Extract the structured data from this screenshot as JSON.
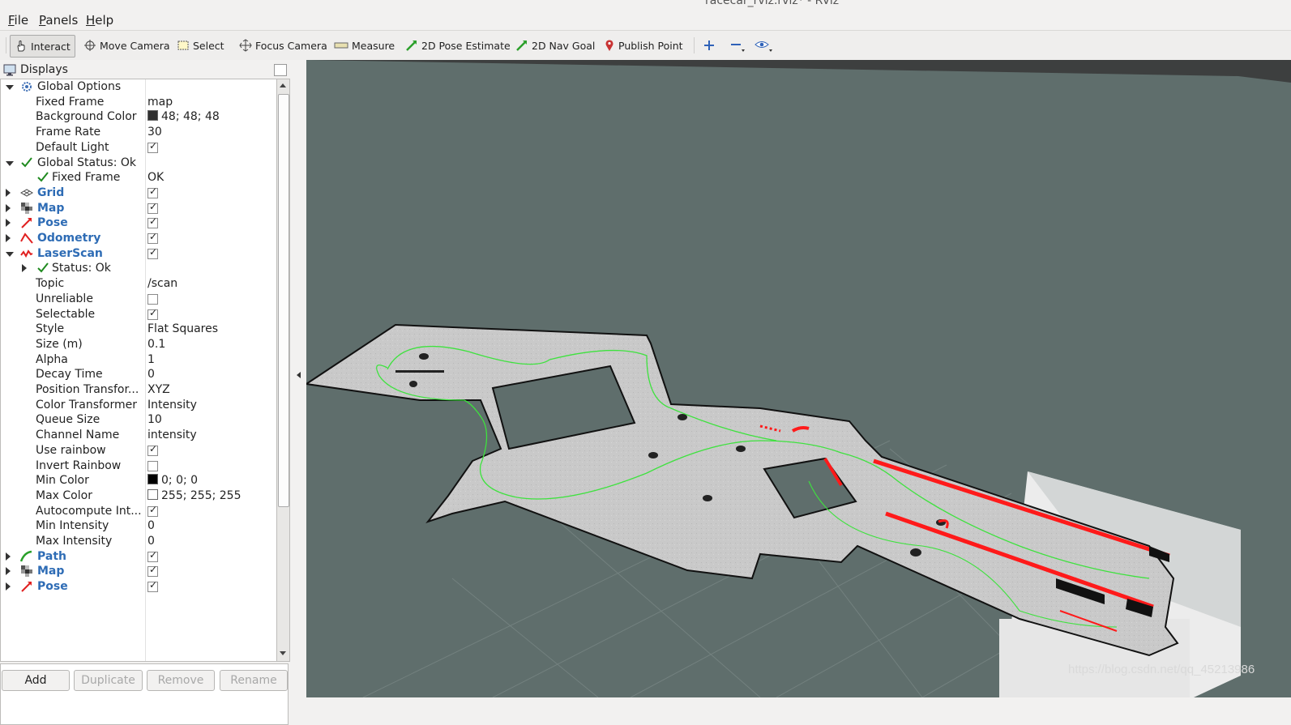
{
  "window": {
    "title": "racecar_rviz.rviz* - RViz"
  },
  "menu": {
    "file": "File",
    "panels": "Panels",
    "help": "Help"
  },
  "toolbar": {
    "interact": "Interact",
    "move_camera": "Move Camera",
    "select": "Select",
    "focus_camera": "Focus Camera",
    "measure": "Measure",
    "pose_estimate": "2D Pose Estimate",
    "nav_goal": "2D Nav Goal",
    "publish_point": "Publish Point"
  },
  "displays_panel": {
    "title": "Displays",
    "rows": [
      {
        "label": "Global Options",
        "value": ""
      },
      {
        "label": "Fixed Frame",
        "value": "map"
      },
      {
        "label": "Background Color",
        "value": "48; 48; 48",
        "color": "#303030"
      },
      {
        "label": "Frame Rate",
        "value": "30"
      },
      {
        "label": "Default Light",
        "checked": true
      },
      {
        "label": "Global Status: Ok",
        "value": ""
      },
      {
        "label": "Fixed Frame",
        "value": "OK"
      },
      {
        "label": "Grid",
        "checked": true
      },
      {
        "label": "Map",
        "checked": true
      },
      {
        "label": "Pose",
        "checked": true
      },
      {
        "label": "Odometry",
        "checked": true
      },
      {
        "label": "LaserScan",
        "checked": true
      },
      {
        "label": "Status: Ok",
        "value": ""
      },
      {
        "label": "Topic",
        "value": "/scan"
      },
      {
        "label": "Unreliable",
        "checked": false
      },
      {
        "label": "Selectable",
        "checked": true
      },
      {
        "label": "Style",
        "value": "Flat Squares"
      },
      {
        "label": "Size (m)",
        "value": "0.1"
      },
      {
        "label": "Alpha",
        "value": "1"
      },
      {
        "label": "Decay Time",
        "value": "0"
      },
      {
        "label": "Position Transfor...",
        "value": "XYZ"
      },
      {
        "label": "Color Transformer",
        "value": "Intensity"
      },
      {
        "label": "Queue Size",
        "value": "10"
      },
      {
        "label": "Channel Name",
        "value": "intensity"
      },
      {
        "label": "Use rainbow",
        "checked": true
      },
      {
        "label": "Invert Rainbow",
        "checked": false
      },
      {
        "label": "Min Color",
        "value": "0; 0; 0",
        "color": "#000000"
      },
      {
        "label": "Max Color",
        "value": "255; 255; 255",
        "color": "#ffffff"
      },
      {
        "label": "Autocompute Int...",
        "checked": true
      },
      {
        "label": "Min Intensity",
        "value": "0"
      },
      {
        "label": "Max Intensity",
        "value": "0"
      },
      {
        "label": "Path",
        "checked": true
      },
      {
        "label": "Map",
        "checked": true
      },
      {
        "label": "Pose",
        "checked": true
      }
    ]
  },
  "buttons": {
    "add": "Add",
    "duplicate": "Duplicate",
    "remove": "Remove",
    "rename": "Rename"
  },
  "watermark": "https://blog.csdn.net/qq_45213986",
  "colors": {
    "laser": "#ff1a1a",
    "path": "#33dd33",
    "map_free": "#c6c6c6",
    "viewport_bg": "#5f6e6c",
    "link_blue": "#2e6cb5"
  }
}
